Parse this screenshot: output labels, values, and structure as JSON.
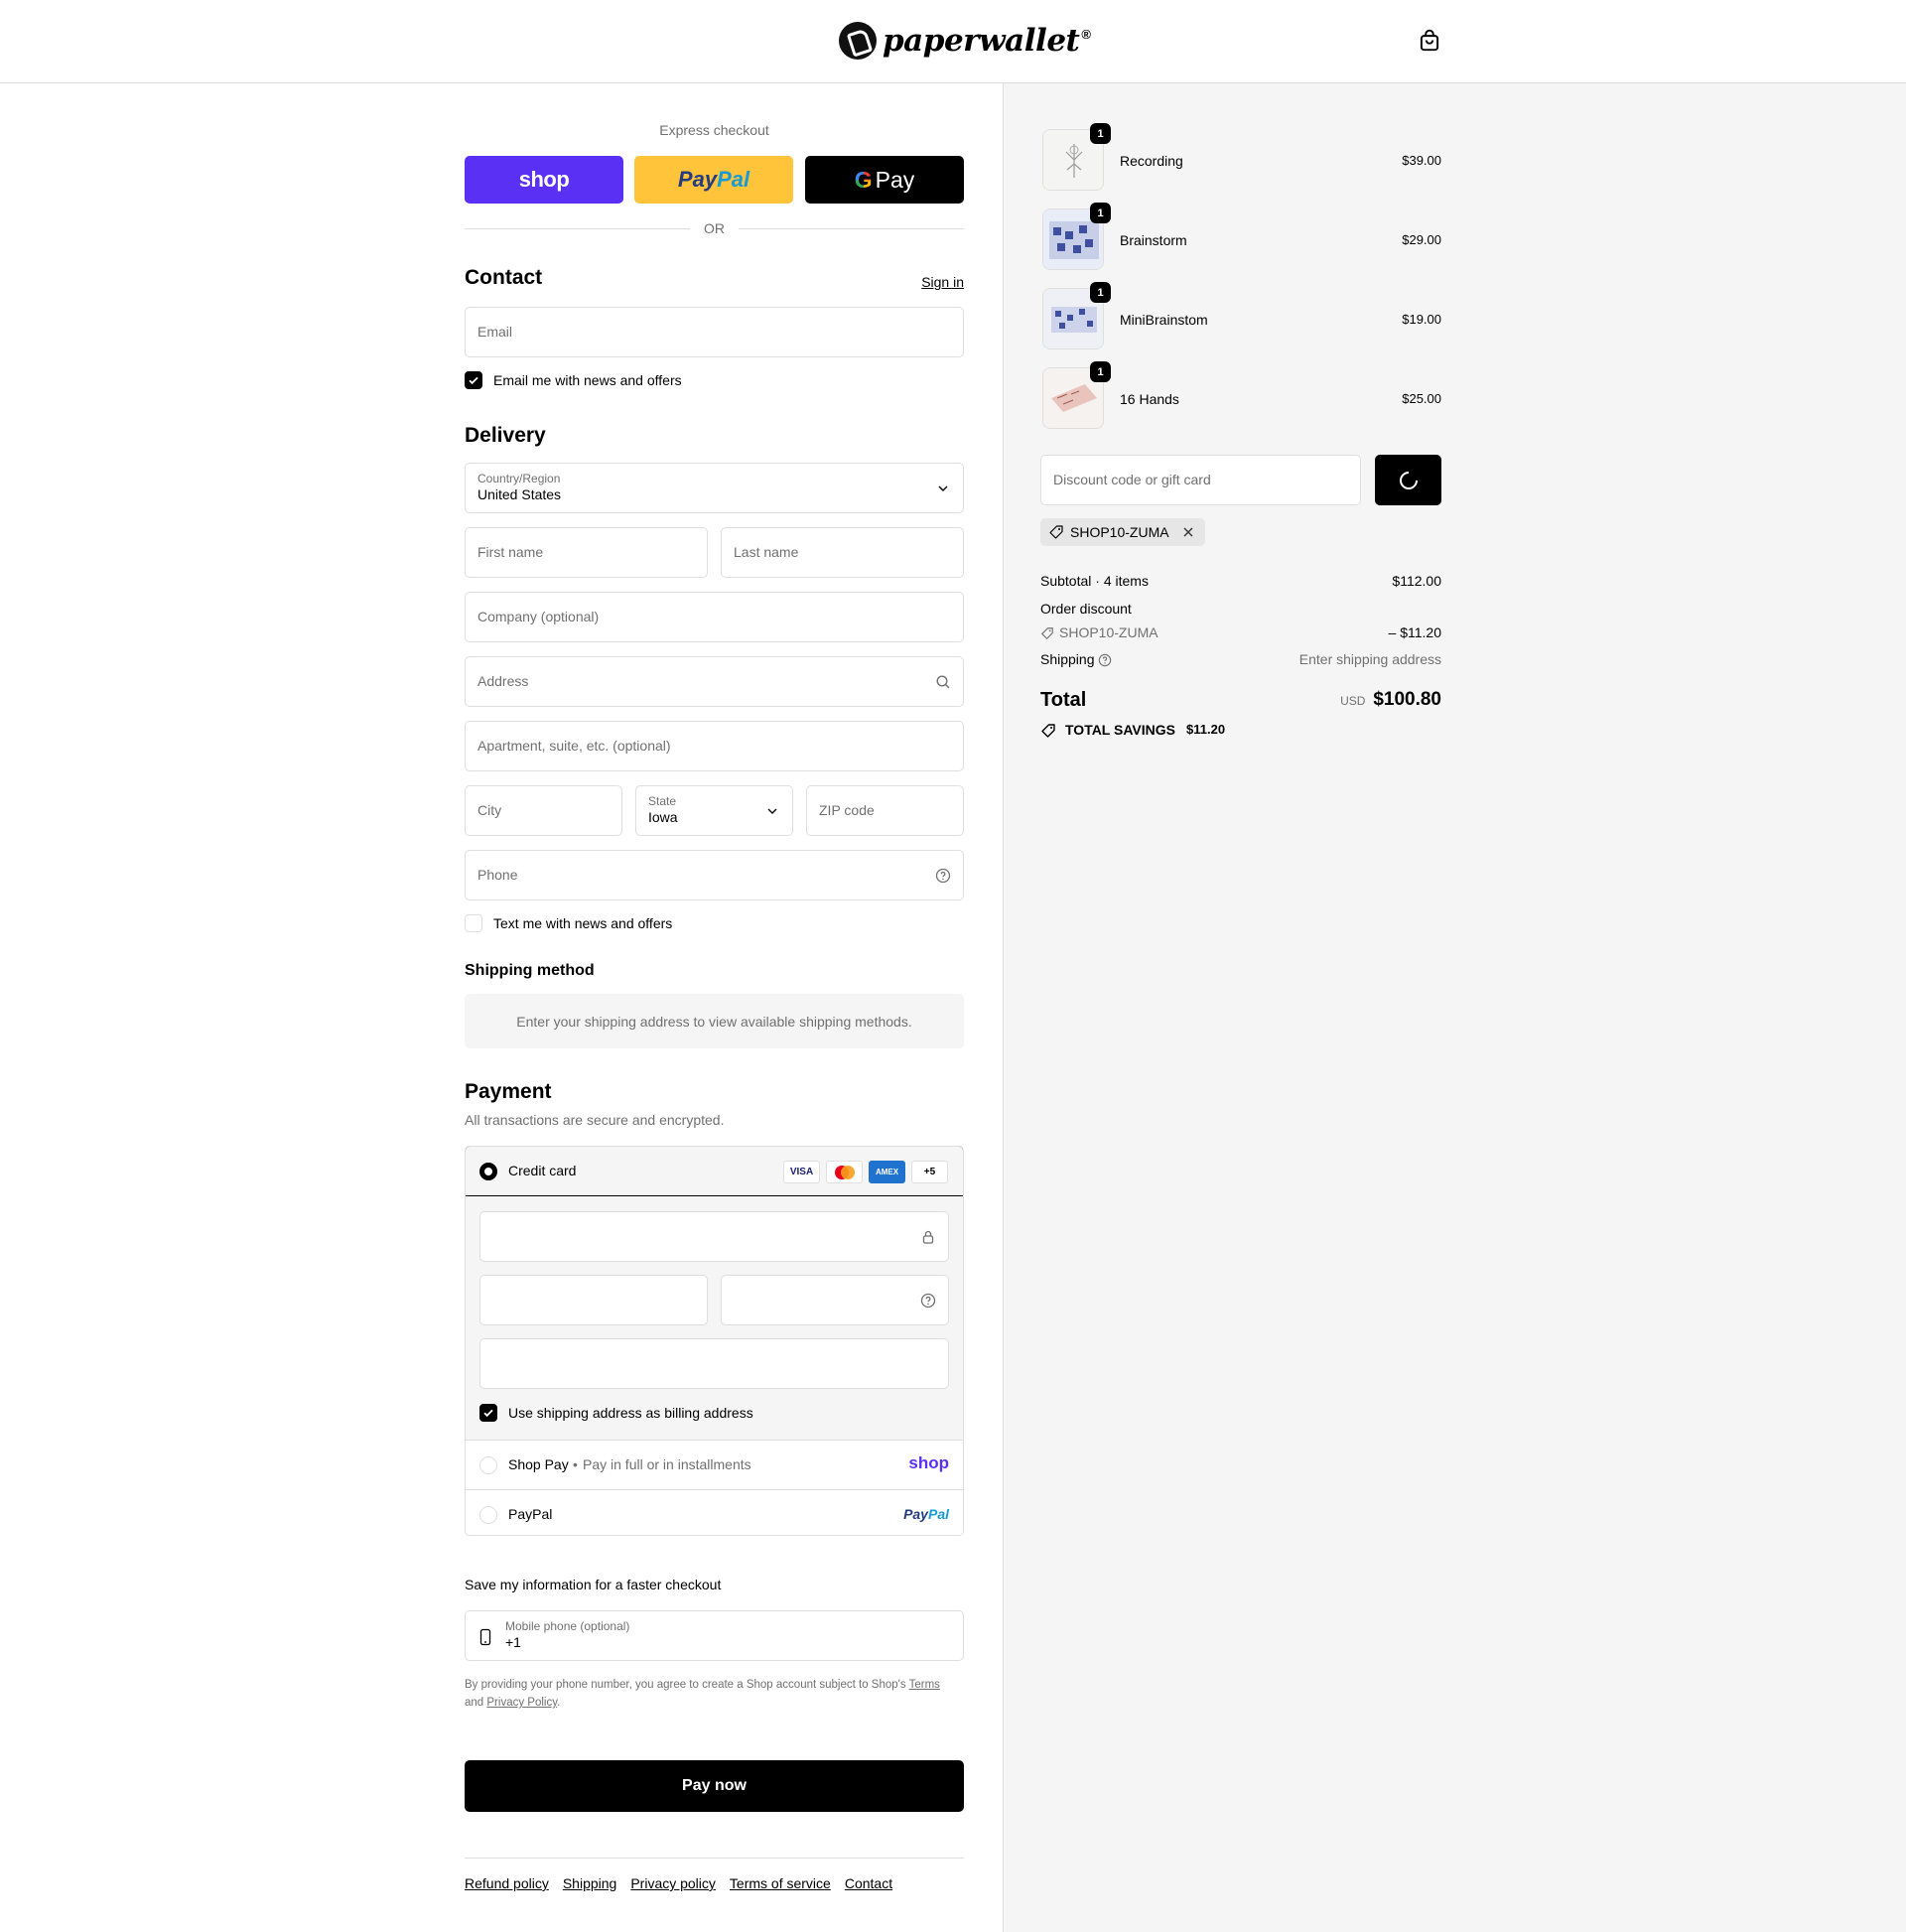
{
  "header": {
    "brand": "paperwallet",
    "brand_mark": "®",
    "cart_icon": "shopping-bag-icon"
  },
  "express": {
    "title": "Express checkout",
    "shop_label": "shop",
    "paypal_label_1": "Pay",
    "paypal_label_2": "Pal",
    "gpay_g": "G",
    "gpay_label": "Pay",
    "or_label": "OR"
  },
  "contact": {
    "title": "Contact",
    "sign_in": "Sign in",
    "email_placeholder": "Email",
    "news_checkbox": {
      "label": "Email me with news and offers",
      "checked": true
    }
  },
  "delivery": {
    "title": "Delivery",
    "country_label": "Country/Region",
    "country_value": "United States",
    "first_name": "First name",
    "last_name": "Last name",
    "company": "Company (optional)",
    "address": "Address",
    "apartment": "Apartment, suite, etc. (optional)",
    "city": "City",
    "state_label": "State",
    "state_value": "Iowa",
    "zip": "ZIP code",
    "phone": "Phone",
    "text_checkbox": {
      "label": "Text me with news and offers",
      "checked": false
    }
  },
  "shipping_method": {
    "title": "Shipping method",
    "message": "Enter your shipping address to view available shipping methods."
  },
  "payment": {
    "title": "Payment",
    "subtitle": "All transactions are secure and encrypted.",
    "credit_card": {
      "label": "Credit card",
      "selected": true
    },
    "card_brands": [
      "VISA",
      "Mastercard",
      "AMEX",
      "+5"
    ],
    "billing_checkbox": {
      "label": "Use shipping address as billing address",
      "checked": true
    },
    "shop_pay": {
      "label": "Shop Pay",
      "sub": "Pay in full or in installments",
      "logo": "shop"
    },
    "paypal": {
      "label": "PayPal",
      "logo_1": "Pay",
      "logo_2": "Pal"
    }
  },
  "save_info": {
    "title": "Save my information for a faster checkout",
    "mobile_label": "Mobile phone (optional)",
    "mobile_value": "+1",
    "legal_text": "By providing your phone number, you agree to create a Shop account subject to Shop's",
    "terms": "Terms",
    "and": "and",
    "privacy": "Privacy Policy",
    "period": "."
  },
  "pay_now": "Pay now",
  "footer_links": [
    "Refund policy",
    "Shipping",
    "Privacy policy",
    "Terms of service",
    "Contact"
  ],
  "summary": {
    "items": [
      {
        "name": "Recording",
        "qty": "1",
        "price": "$39.00"
      },
      {
        "name": "Brainstorm",
        "qty": "1",
        "price": "$29.00"
      },
      {
        "name": "MiniBrainstom",
        "qty": "1",
        "price": "$19.00"
      },
      {
        "name": "16 Hands",
        "qty": "1",
        "price": "$25.00"
      }
    ],
    "discount_placeholder": "Discount code or gift card",
    "applied_code": "SHOP10-ZUMA",
    "subtotal_label": "Subtotal · 4 items",
    "subtotal_value": "$112.00",
    "order_discount_label": "Order discount",
    "discount_code": "SHOP10-ZUMA",
    "discount_value": "– $11.20",
    "shipping_label": "Shipping",
    "shipping_value": "Enter shipping address",
    "total_label": "Total",
    "currency": "USD",
    "total_value": "$100.80",
    "savings_label": "TOTAL SAVINGS",
    "savings_value": "$11.20"
  }
}
